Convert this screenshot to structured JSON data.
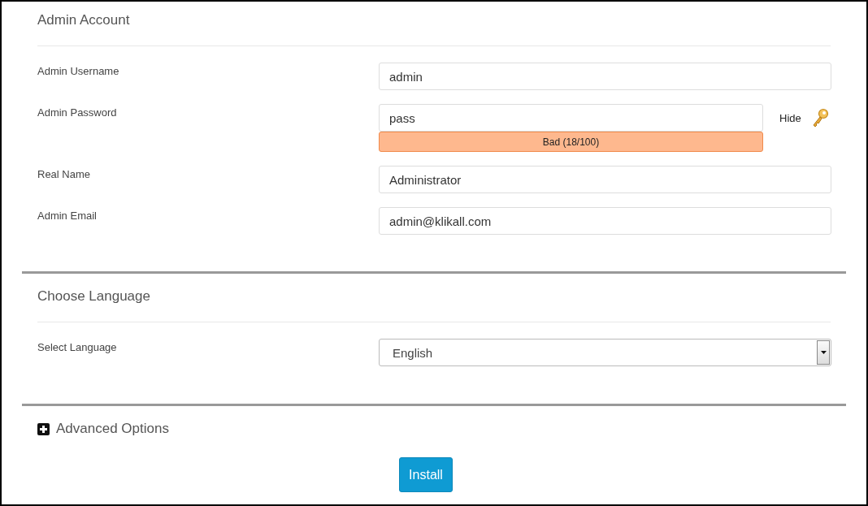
{
  "sections": [
    {
      "title": "Admin Account",
      "fields": [
        {
          "kind": "text",
          "label": "Admin Username",
          "value": "admin"
        },
        {
          "kind": "password",
          "label": "Admin Password",
          "value": "pass",
          "toggle": "Hide",
          "strength": {
            "kind": "bad",
            "text": "Bad (18/100)"
          }
        },
        {
          "kind": "text",
          "label": "Real Name",
          "value": "Administrator"
        },
        {
          "kind": "text",
          "label": "Admin Email",
          "value": "admin@klikall.com"
        }
      ]
    },
    {
      "title": "Choose Language",
      "fields": [
        {
          "kind": "select",
          "label": "Select Language",
          "value": "English"
        }
      ]
    }
  ],
  "advanced": {
    "label": "Advanced Options",
    "expanded": false
  },
  "install_button": "Install"
}
